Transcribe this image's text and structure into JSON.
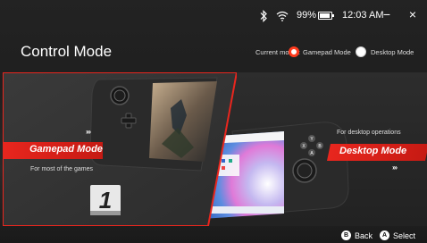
{
  "status": {
    "battery": "99%",
    "time": "12:03 AM",
    "minimize": "−",
    "close": "×"
  },
  "page": {
    "title": "Control Mode",
    "current_mode_label": "Current mode :",
    "options": [
      {
        "label": "Gamepad Mode",
        "selected": true
      },
      {
        "label": "Desktop Mode",
        "selected": false
      }
    ]
  },
  "gamepad_card": {
    "title": "Gamepad Mode",
    "description": "For most of the games",
    "arrows": "›››",
    "badge": "1"
  },
  "desktop_card": {
    "title": "Desktop Mode",
    "description": "For desktop operations",
    "arrows": "›››"
  },
  "footer": {
    "back_button": "B",
    "back_label": "Back",
    "select_button": "A",
    "select_label": "Select"
  },
  "colors": {
    "accent": "#e8261e",
    "background": "#1f1f1f"
  }
}
